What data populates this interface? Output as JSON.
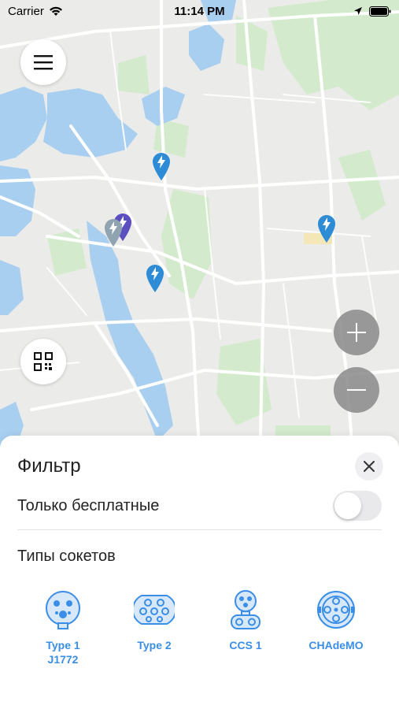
{
  "status_bar": {
    "carrier": "Carrier",
    "time": "11:14 PM"
  },
  "map": {
    "icons": {
      "menu": "hamburger-menu-icon",
      "qr": "qr-code-icon",
      "zoom_in": "plus-icon",
      "zoom_out": "minus-icon",
      "marker": "charging-station-marker-icon"
    }
  },
  "filter": {
    "title": "Фильтр",
    "free_only_label": "Только бесплатные",
    "free_only_enabled": false,
    "socket_types_label": "Типы сокетов",
    "sockets": [
      {
        "label": "Type 1\nJ1772",
        "icon": "type1-connector-icon"
      },
      {
        "label": "Type 2",
        "icon": "type2-connector-icon"
      },
      {
        "label": "CCS 1",
        "icon": "ccs1-connector-icon"
      },
      {
        "label": "CHAdeMO",
        "icon": "chademo-connector-icon"
      }
    ]
  },
  "colors": {
    "accent": "#3a8ee6",
    "water": "#a9cff0",
    "park": "#cfe9c8",
    "road": "#ffffff"
  }
}
